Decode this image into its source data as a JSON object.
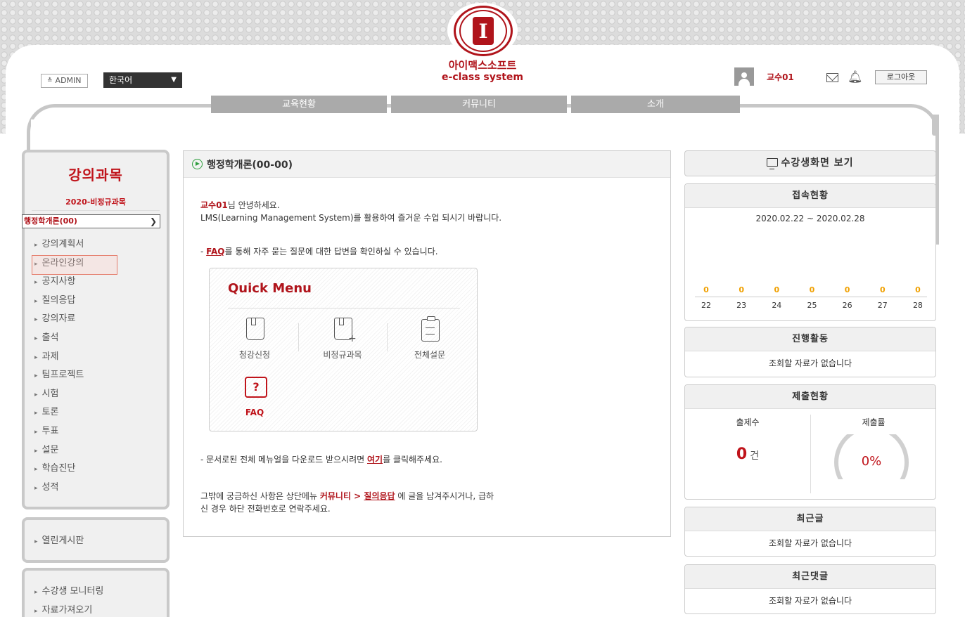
{
  "header": {
    "admin_label": "ADMIN",
    "language": "한국어",
    "brand_name": "아이맥스소프트",
    "brand_sub": "e-class system",
    "username": "교수01",
    "logout_label": "로그아웃"
  },
  "nav": [
    "교육현황",
    "커뮤니티",
    "소개"
  ],
  "sidebar": {
    "title": "강의과목",
    "category": "2020-비정규과목",
    "course_select": "행정학개론(00)",
    "items": [
      "강의계획서",
      "온라인강의",
      "공지사항",
      "질의응답",
      "강의자료",
      "출석",
      "과제",
      "팀프로젝트",
      "시험",
      "토론",
      "투표",
      "설문",
      "학습진단",
      "성적"
    ],
    "highlighted_item": "온라인강의",
    "board": "열린게시판",
    "tools": [
      "수강생 모니터링",
      "자료가져오기"
    ]
  },
  "main": {
    "title": "행정학개론(00-00)",
    "greeting_name": "교수01",
    "greeting_rest": "님 안녕하세요.",
    "intro": "LMS(Learning Management System)를 활용하여 즐거운 수업 되시기 바랍니다.",
    "faq_prefix": "- ",
    "faq_link": "FAQ",
    "faq_rest": "를 통해 자주 묻는 질문에 대한 답변을 확인하실 수 있습니다.",
    "quick_menu": {
      "title": "Quick Menu",
      "items": [
        "청강신청",
        "비정규과목",
        "전체설문",
        "FAQ"
      ]
    },
    "manual_prefix": "- 문서로된 전체 메뉴얼을 다운로드 받으시려면 ",
    "manual_link": "여기",
    "manual_rest": "를 클릭해주세요.",
    "help_prefix": "그밖에 궁금하신 사항은 상단메뉴 ",
    "help_menu": "커뮤니티 > ",
    "help_link": "질의응답",
    "help_rest_1": " 에 글을 남겨주시거나, 급하",
    "help_rest_2": "신 경우 하단 전화번호로 연락주세요."
  },
  "right": {
    "student_view": "수강생화면 보기",
    "access": {
      "title": "접속현황",
      "range": "2020.02.22 ~ 2020.02.28",
      "values": [
        "0",
        "0",
        "0",
        "0",
        "0",
        "0",
        "0"
      ],
      "days": [
        "22",
        "23",
        "24",
        "25",
        "26",
        "27",
        "28"
      ]
    },
    "progress": {
      "title": "진행활동",
      "empty": "조회할 자료가 없습니다"
    },
    "submission": {
      "title": "제출현황",
      "count_label": "출제수",
      "rate_label": "제출률",
      "count": "0",
      "count_unit": "건",
      "rate": "0%"
    },
    "recent_posts": {
      "title": "최근글",
      "empty": "조회할 자료가 없습니다"
    },
    "recent_comments": {
      "title": "최근댓글",
      "empty": "조회할 자료가 없습니다"
    }
  },
  "colors": {
    "accent": "#b0141b",
    "nav_gray": "#aaaaaa",
    "chart_value": "#f0a000"
  }
}
